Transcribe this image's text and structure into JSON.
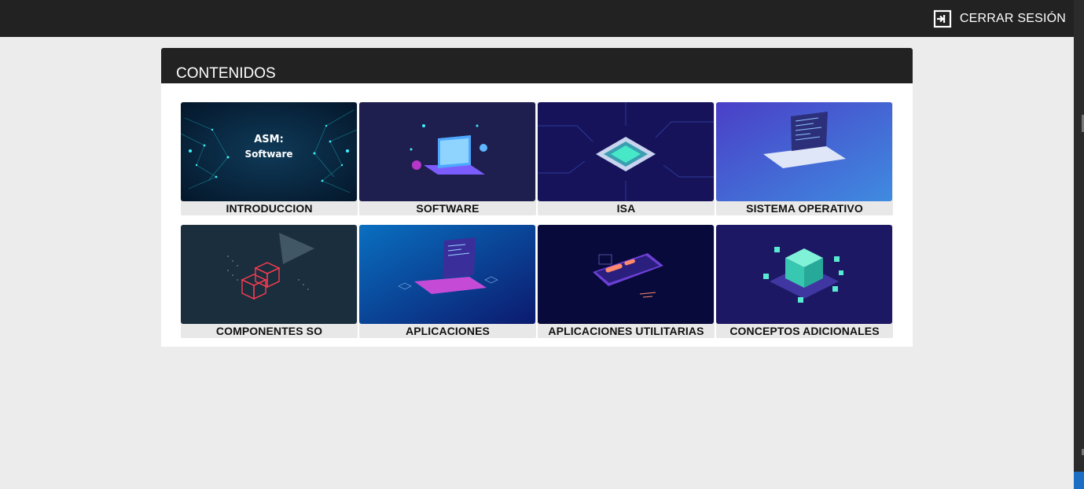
{
  "header": {
    "logout_label": "CERRAR SESIÓN",
    "logout_icon": "logout-icon",
    "background": "#222222"
  },
  "panel": {
    "title": "CONTENIDOS"
  },
  "cards": [
    {
      "label": "INTRODUCCION",
      "thumb_text_1": "ASM:",
      "thumb_text_2": "Software",
      "thumb_icon": "circuit-network-image"
    },
    {
      "label": "SOFTWARE",
      "thumb_icon": "isometric-laptop-image"
    },
    {
      "label": "ISA",
      "thumb_icon": "cpu-chip-image"
    },
    {
      "label": "SISTEMA OPERATIVO",
      "thumb_icon": "laptop-code-image"
    },
    {
      "label": "COMPONENTES SO",
      "thumb_icon": "cubes-projection-image"
    },
    {
      "label": "APLICACIONES",
      "thumb_icon": "laptop-app-image"
    },
    {
      "label": "APLICACIONES UTILITARIAS",
      "thumb_icon": "phone-app-image"
    },
    {
      "label": "CONCEPTOS ADICIONALES",
      "thumb_icon": "data-blocks-image"
    }
  ],
  "colors": {
    "page_bg": "#ececec",
    "panel_bg": "#ffffff",
    "card_bg": "#e8e8e8",
    "accent_blue": "#1a6fc4"
  }
}
